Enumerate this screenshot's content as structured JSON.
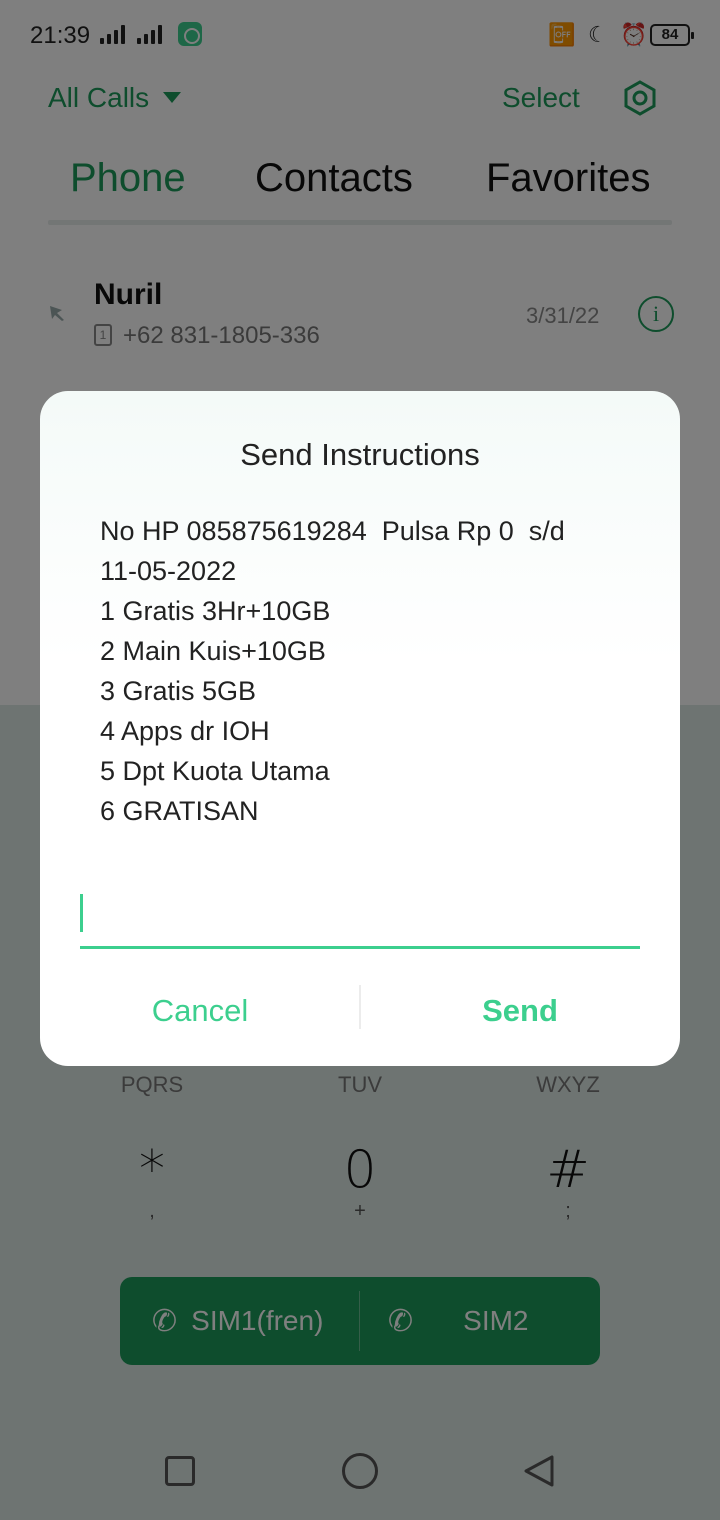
{
  "status_bar": {
    "time": "21:39",
    "battery": "84"
  },
  "header": {
    "filter_label": "All Calls",
    "select_label": "Select"
  },
  "tabs": [
    {
      "label": "Phone",
      "active": true
    },
    {
      "label": "Contacts",
      "active": false
    },
    {
      "label": "Favorites",
      "active": false
    }
  ],
  "call_log": [
    {
      "name": "Nuril",
      "sim": "1",
      "number": "+62 831-1805-336",
      "date": "3/31/22"
    }
  ],
  "keypad": {
    "letters": [
      "PQRS",
      "TUV",
      "WXYZ"
    ],
    "keys": [
      {
        "main": "*",
        "sub": ","
      },
      {
        "main": "0",
        "sub": "+"
      },
      {
        "main": "#",
        "sub": ";"
      }
    ]
  },
  "sim_buttons": [
    {
      "label": "SIM1(fren)",
      "badge": "1"
    },
    {
      "label": "SIM2",
      "badge": "2"
    }
  ],
  "dialog": {
    "title": "Send Instructions",
    "body_lines": [
      "No HP 085875619284  Pulsa Rp 0  s/d",
      "11-05-2022",
      "1 Gratis 3Hr+10GB",
      "2 Main Kuis+10GB",
      "3 Gratis 5GB",
      "4 Apps dr IOH",
      "5 Dpt Kuota Utama",
      "6 GRATISAN"
    ],
    "input_value": "",
    "cancel_label": "Cancel",
    "send_label": "Send"
  },
  "colors": {
    "brand_green": "#1c9a5a",
    "dialog_accent": "#3ccf8e",
    "scrim": "rgba(0,0,0,0.5)"
  }
}
